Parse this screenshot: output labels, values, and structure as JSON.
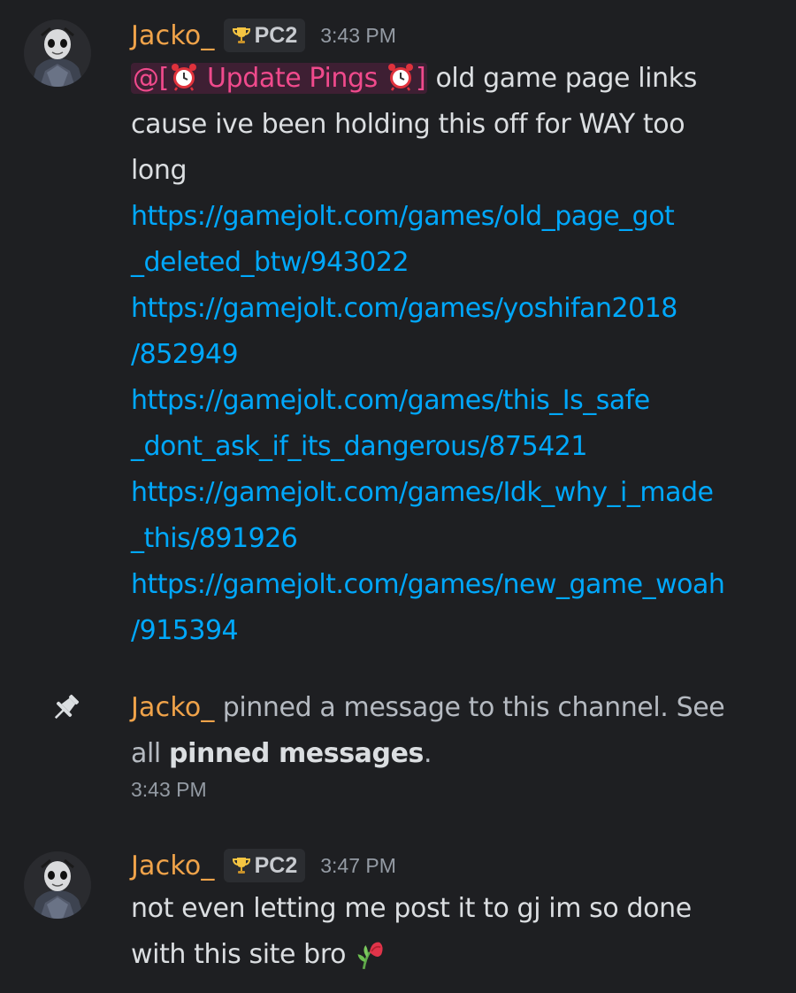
{
  "colors": {
    "background": "#1e1f22",
    "username": "#f0a34a",
    "link": "#00a8fc",
    "mention_text": "#f04a8c",
    "message_text": "#dbdee1",
    "muted_text": "#949ba4"
  },
  "messages": [
    {
      "author": "Jacko_",
      "tag": "PC2",
      "tag_icon": "trophy-icon",
      "timestamp": "3:43 PM",
      "mention": {
        "prefix": "@[",
        "label": " Update Pings ",
        "suffix": "]",
        "emoji": "alarm-clock-icon"
      },
      "lines": [
        " old game page links",
        "cause ive been holding this off for WAY too",
        "long"
      ],
      "links": [
        "https://gamejolt.com/games/old_page_got",
        "_deleted_btw/943022",
        "https://gamejolt.com/games/yoshifan2018",
        "/852949",
        "https://gamejolt.com/games/this_Is_safe",
        "_dont_ask_if_its_dangerous/875421",
        "https://gamejolt.com/games/Idk_why_i_made",
        "_this/891926",
        "https://gamejolt.com/games/new_game_woah",
        "/915394"
      ]
    }
  ],
  "system": {
    "icon": "pin-icon",
    "author": "Jacko_",
    "text_1": " pinned a message to this channel. See",
    "text_2a": "all ",
    "text_2_bold": "pinned messages",
    "text_2b": ".",
    "timestamp": "3:43 PM"
  },
  "message2": {
    "author": "Jacko_",
    "tag": "PC2",
    "tag_icon": "trophy-icon",
    "timestamp": "3:47 PM",
    "lines": [
      "not even letting me post it to gj im so done",
      "with this site bro "
    ],
    "emoji": "wilted-flower-icon"
  }
}
